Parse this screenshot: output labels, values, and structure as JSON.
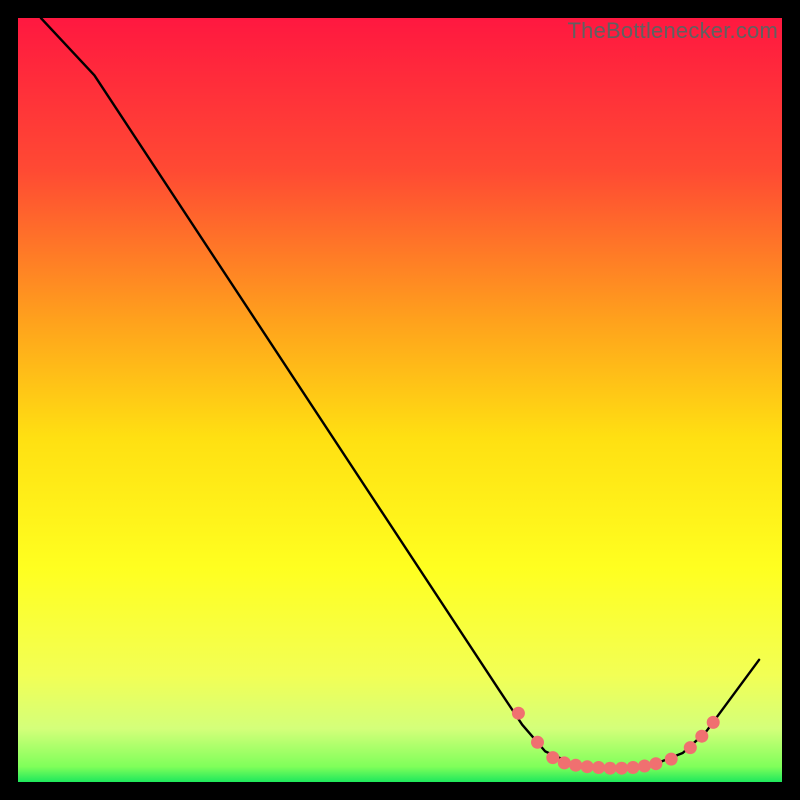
{
  "watermark": "TheBottlenecker.com",
  "chart_data": {
    "type": "line",
    "title": "",
    "xlabel": "",
    "ylabel": "",
    "xlim": [
      0,
      100
    ],
    "ylim": [
      0,
      100
    ],
    "gradient_stops": [
      {
        "offset": 0.0,
        "color": "#ff1840"
      },
      {
        "offset": 0.2,
        "color": "#ff4a33"
      },
      {
        "offset": 0.4,
        "color": "#ffa31c"
      },
      {
        "offset": 0.55,
        "color": "#ffe012"
      },
      {
        "offset": 0.72,
        "color": "#ffff20"
      },
      {
        "offset": 0.86,
        "color": "#f2ff55"
      },
      {
        "offset": 0.93,
        "color": "#d4ff7a"
      },
      {
        "offset": 0.98,
        "color": "#7fff5a"
      },
      {
        "offset": 1.0,
        "color": "#1ee85c"
      }
    ],
    "series": [
      {
        "name": "curve",
        "points": [
          {
            "x": 3.0,
            "y": 100.0
          },
          {
            "x": 10.0,
            "y": 92.5
          },
          {
            "x": 63.0,
            "y": 12.0
          },
          {
            "x": 66.0,
            "y": 7.5
          },
          {
            "x": 69.0,
            "y": 4.0
          },
          {
            "x": 73.0,
            "y": 2.2
          },
          {
            "x": 78.0,
            "y": 1.8
          },
          {
            "x": 83.0,
            "y": 2.2
          },
          {
            "x": 87.0,
            "y": 3.8
          },
          {
            "x": 90.0,
            "y": 6.5
          },
          {
            "x": 97.0,
            "y": 16.0
          }
        ]
      }
    ],
    "markers": [
      {
        "x": 65.5,
        "y": 9.0
      },
      {
        "x": 68.0,
        "y": 5.2
      },
      {
        "x": 70.0,
        "y": 3.2
      },
      {
        "x": 71.5,
        "y": 2.5
      },
      {
        "x": 73.0,
        "y": 2.2
      },
      {
        "x": 74.5,
        "y": 2.0
      },
      {
        "x": 76.0,
        "y": 1.9
      },
      {
        "x": 77.5,
        "y": 1.8
      },
      {
        "x": 79.0,
        "y": 1.8
      },
      {
        "x": 80.5,
        "y": 1.9
      },
      {
        "x": 82.0,
        "y": 2.1
      },
      {
        "x": 83.5,
        "y": 2.4
      },
      {
        "x": 85.5,
        "y": 3.0
      },
      {
        "x": 88.0,
        "y": 4.5
      },
      {
        "x": 89.5,
        "y": 6.0
      },
      {
        "x": 91.0,
        "y": 7.8
      }
    ],
    "marker_color": "#f07070"
  }
}
